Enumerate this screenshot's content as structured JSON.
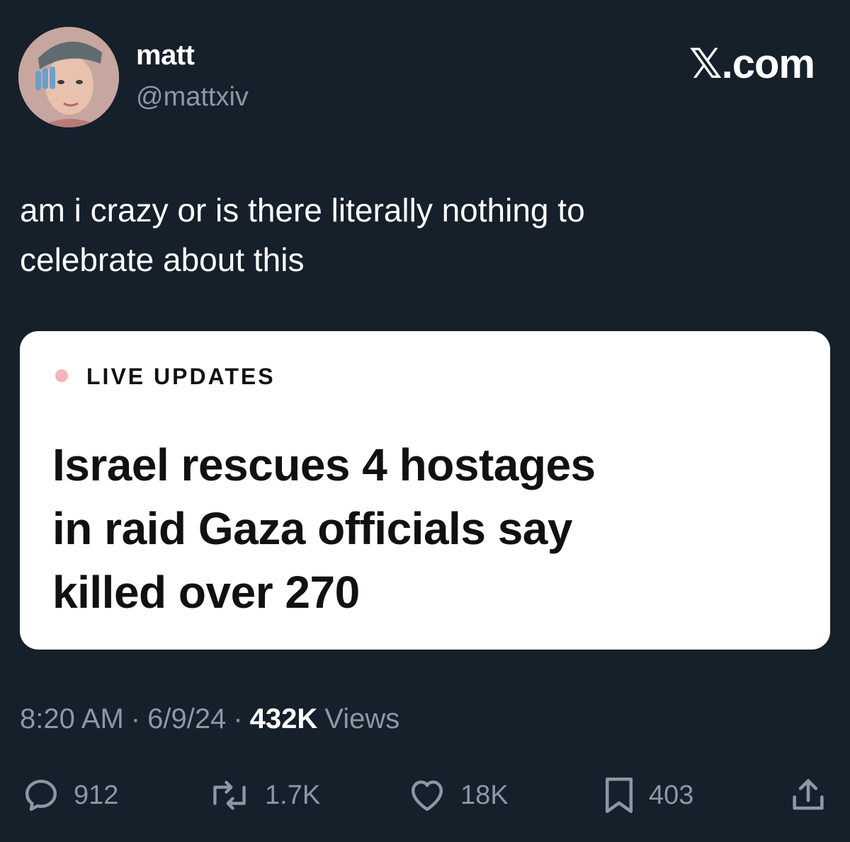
{
  "author": {
    "name": "matt",
    "handle": "@mattxiv"
  },
  "brand": {
    "mark": "𝕏",
    "label": ".com"
  },
  "tweet": {
    "text_line1": "am i crazy or is there literally nothing to",
    "text_line2": "celebrate about this"
  },
  "card": {
    "label": "LIVE UPDATES",
    "headline_line1": "Israel rescues 4 hostages",
    "headline_line2": "in raid Gaza officials say",
    "headline_line3": "killed over 270"
  },
  "meta": {
    "time": "8:20 AM",
    "separator": "·",
    "date": "6/9/24",
    "views_count": "432K",
    "views_label": "Views"
  },
  "actions": {
    "replies": "912",
    "reposts": "1.7K",
    "likes": "18K",
    "bookmarks": "403"
  },
  "colors": {
    "background": "#15202b",
    "secondary_text": "#8b98a5",
    "live_dot": "#f5b4b8"
  }
}
